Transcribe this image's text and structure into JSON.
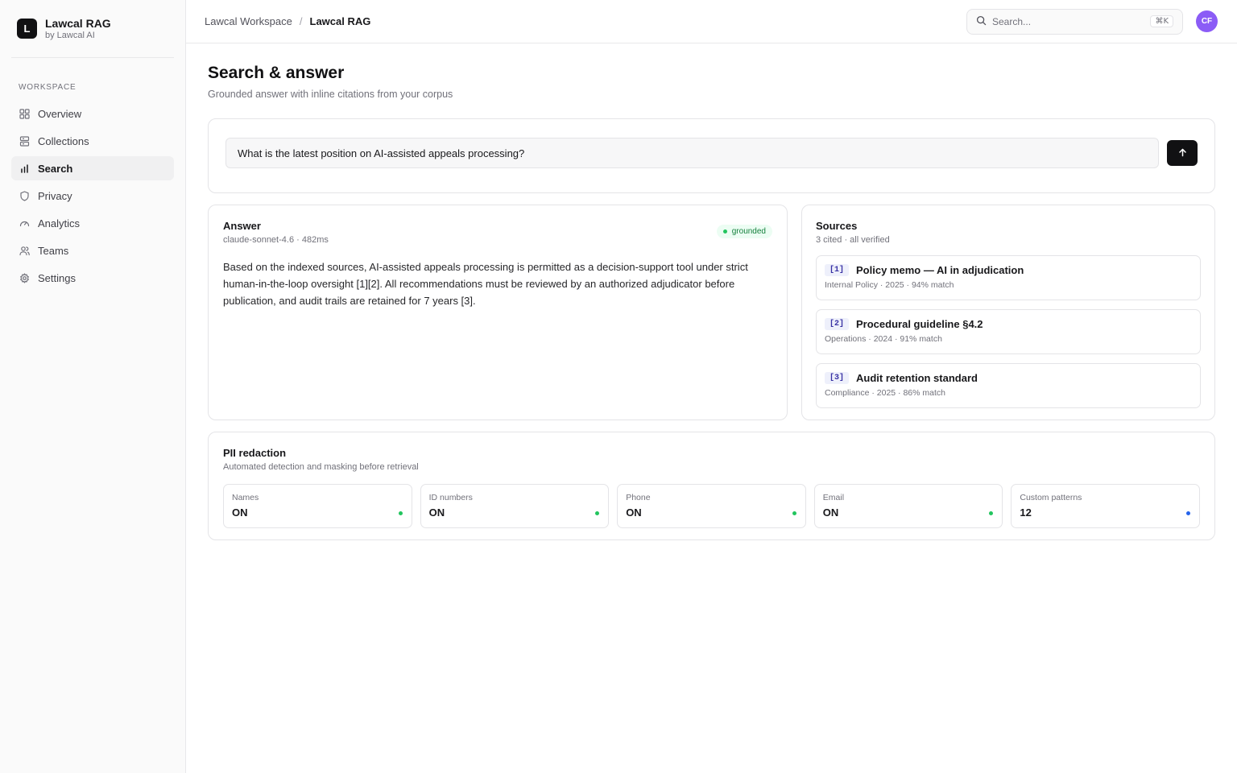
{
  "brand": {
    "logo_letter": "L",
    "name": "Lawcal RAG",
    "sub": "by Lawcal AI"
  },
  "sidebar": {
    "section_label": "WORKSPACE",
    "items": [
      {
        "label": "Overview",
        "icon": "grid-icon"
      },
      {
        "label": "Collections",
        "icon": "database-icon"
      },
      {
        "label": "Search",
        "icon": "bar-chart-icon",
        "active": true
      },
      {
        "label": "Privacy",
        "icon": "shield-icon"
      },
      {
        "label": "Analytics",
        "icon": "gauge-icon"
      },
      {
        "label": "Teams",
        "icon": "users-icon"
      },
      {
        "label": "Settings",
        "icon": "gear-icon"
      }
    ]
  },
  "topbar": {
    "breadcrumb": [
      "Lawcal Workspace",
      "Lawcal RAG"
    ],
    "separator": "/",
    "search_placeholder": "Search...",
    "search_shortcut": "⌘K",
    "avatar_initials": "CF",
    "avatar_color": "#8b5cf6"
  },
  "page": {
    "title": "Search & answer",
    "subtitle": "Grounded answer with inline citations from your corpus"
  },
  "query": {
    "value": "What is the latest position on AI-assisted appeals processing?"
  },
  "answer": {
    "title": "Answer",
    "meta": "claude-sonnet-4.6 · 482ms",
    "badge": "grounded",
    "text": "Based on the indexed sources, AI-assisted appeals processing is permitted as a decision-support tool under strict human-in-the-loop oversight [1][2]. All recommendations must be reviewed by an authorized adjudicator before publication, and audit trails are retained for 7 years [3]."
  },
  "sources": {
    "title": "Sources",
    "meta": "3 cited · all verified",
    "items": [
      {
        "tag": "[1]",
        "title": "Policy memo — AI in adjudication",
        "meta": "Internal Policy · 2025 · 94% match"
      },
      {
        "tag": "[2]",
        "title": "Procedural guideline §4.2",
        "meta": "Operations · 2024 · 91% match"
      },
      {
        "tag": "[3]",
        "title": "Audit retention standard",
        "meta": "Compliance · 2025 · 86% match"
      }
    ]
  },
  "pii": {
    "title": "PII redaction",
    "subtitle": "Automated detection and masking before retrieval",
    "tiles": [
      {
        "label": "Names",
        "value": "ON",
        "color": "#22c55e"
      },
      {
        "label": "ID numbers",
        "value": "ON",
        "color": "#22c55e"
      },
      {
        "label": "Phone",
        "value": "ON",
        "color": "#22c55e"
      },
      {
        "label": "Email",
        "value": "ON",
        "color": "#22c55e"
      },
      {
        "label": "Custom patterns",
        "value": "12",
        "color": "#2563eb"
      }
    ]
  }
}
